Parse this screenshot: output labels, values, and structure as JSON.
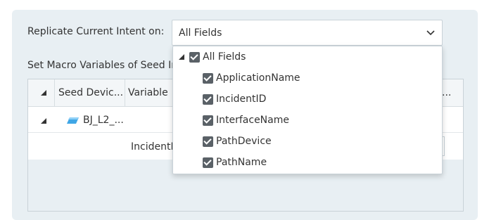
{
  "replicate": {
    "label": "Replicate Current Intent on:",
    "selected_value": "All Fields"
  },
  "macro": {
    "label": "Set Macro Variables of Seed In"
  },
  "grid": {
    "columns": [
      "Seed Devic...",
      "Variable",
      "..."
    ],
    "rows": [
      {
        "device": "BJ_L2_..."
      },
      {
        "variable_text": "IncidentI"
      }
    ]
  },
  "dropdown": {
    "root": {
      "label": "All Fields",
      "checked": true,
      "expanded": true
    },
    "items": [
      {
        "label": "ApplicationName",
        "checked": true
      },
      {
        "label": "IncidentID",
        "checked": true
      },
      {
        "label": "InterfaceName",
        "checked": true
      },
      {
        "label": "PathDevice",
        "checked": true
      },
      {
        "label": "PathName",
        "checked": true
      }
    ]
  },
  "colors": {
    "panel_bg": "#e8eff3",
    "checkbox": "#5a6167",
    "device_icon": "#3fa6e6"
  },
  "icons": {
    "select_chevron": "chevron-down-icon",
    "tree_toggle": "triangle-collapse-icon",
    "device": "switch-device-icon"
  }
}
